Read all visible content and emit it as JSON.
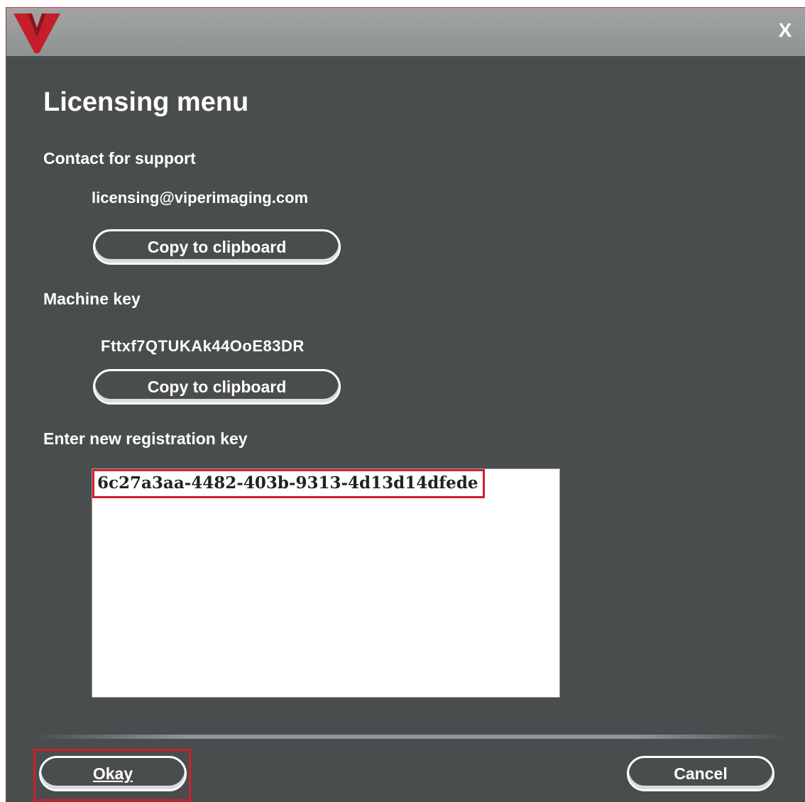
{
  "titlebar": {
    "logo_icon": "viper-logo-icon",
    "close_label": "X"
  },
  "heading": "Licensing menu",
  "support": {
    "label": "Contact for support",
    "email": "licensing@viperimaging.com",
    "copy_label": "Copy to clipboard"
  },
  "machine": {
    "label": "Machine key",
    "key": "Fttxf7QTUKAk44OoE83DR",
    "copy_label": "Copy to clipboard"
  },
  "registration": {
    "label": "Enter new registration key",
    "value": "6c27a3aa-4482-403b-9313-4d13d14dfede"
  },
  "footer": {
    "okay_label": "Okay",
    "cancel_label": "Cancel"
  },
  "colors": {
    "window_bg": "#4a4d4e",
    "titlebar_bg": "#9a9c9c",
    "accent_red": "#c41e2a",
    "highlight_red": "#d0202a"
  }
}
